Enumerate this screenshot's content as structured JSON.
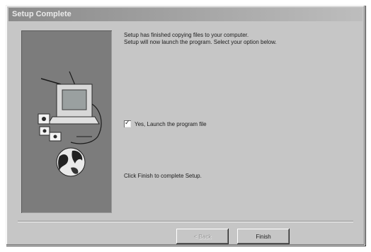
{
  "window": {
    "title": "Setup Complete"
  },
  "content": {
    "message_line1": "Setup has finished copying files to your computer.",
    "message_line2": "Setup will now launch the program. Select your option below.",
    "launch_checkbox_label": "Yes, Launch the program file",
    "launch_checkbox_checked": true,
    "finish_instruction": "Click Finish to complete Setup."
  },
  "buttons": {
    "back_label": "< Back",
    "back_enabled": false,
    "finish_label": "Finish"
  },
  "icons": {
    "panel_illustration": [
      "computer-icon",
      "disks-icon",
      "globe-icon"
    ],
    "checkbox_mark": "✓"
  },
  "colors": {
    "dialog_face": "#c6c6c6",
    "image_panel": "#7c7c7c",
    "titlebar": "#8a8a8a"
  }
}
